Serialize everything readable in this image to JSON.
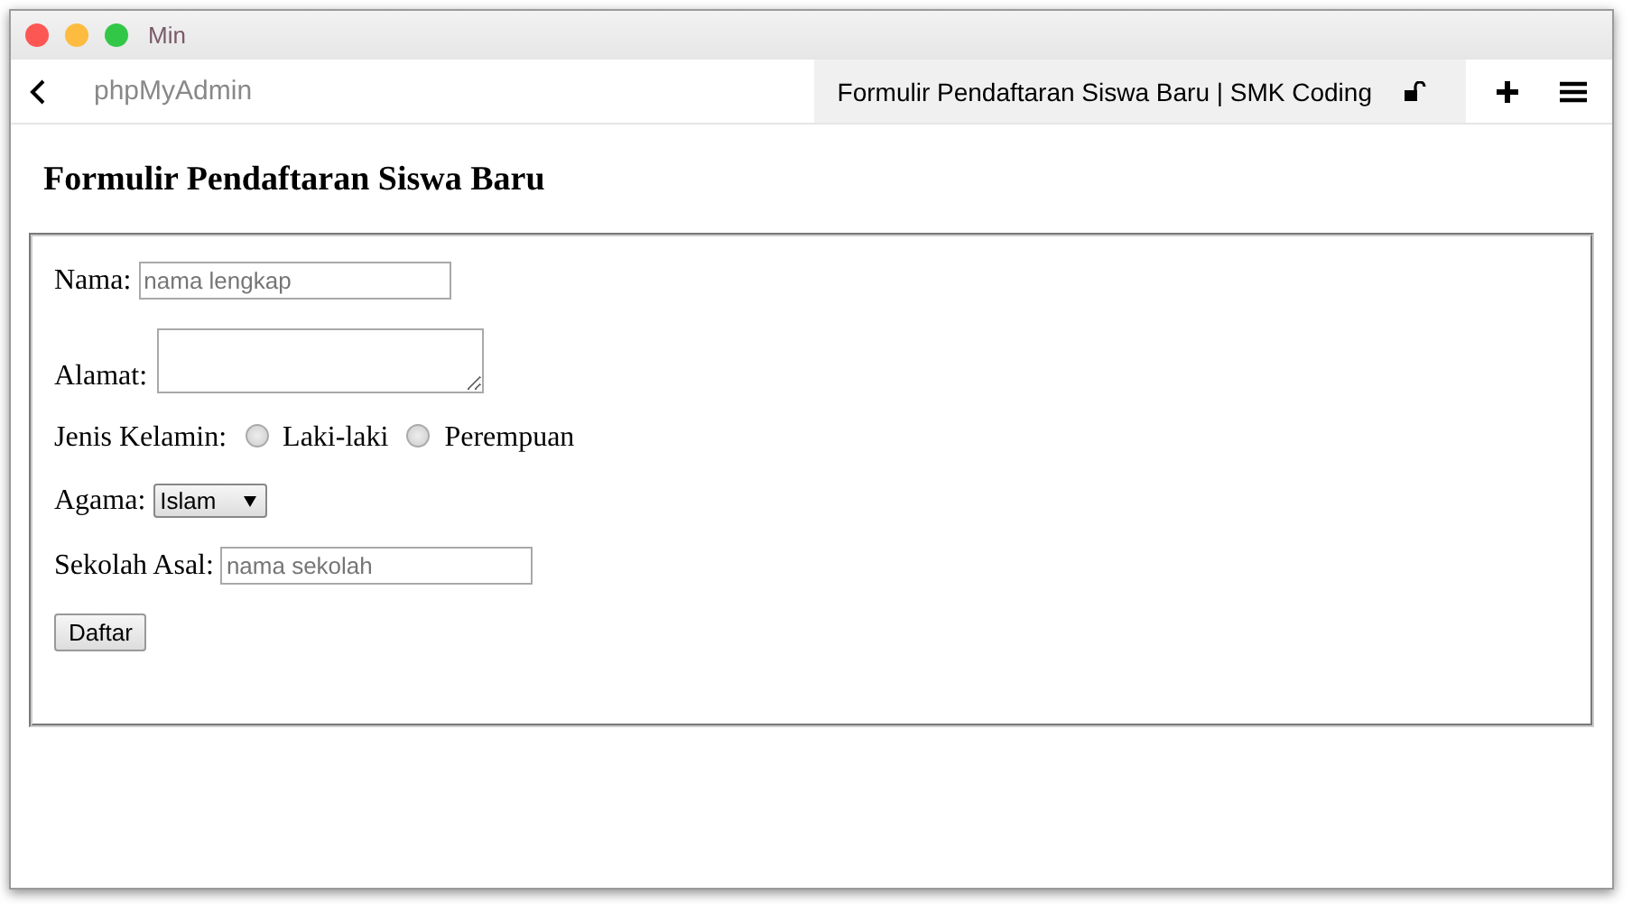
{
  "window": {
    "title": "Min"
  },
  "nav": {
    "back_label": "phpMyAdmin",
    "tab_title": "Formulir Pendaftaran Siswa Baru | SMK Coding"
  },
  "page": {
    "heading": "Formulir Pendaftaran Siswa Baru",
    "name_field": {
      "label": "Nama:",
      "placeholder": "nama lengkap"
    },
    "address_field": {
      "label": "Alamat:"
    },
    "gender": {
      "label": "Jenis Kelamin:",
      "options": [
        {
          "label": "Laki-laki",
          "selected": false
        },
        {
          "label": "Perempuan",
          "selected": false
        }
      ]
    },
    "religion": {
      "label": "Agama:",
      "value": "Islam"
    },
    "school_field": {
      "label": "Sekolah Asal:",
      "placeholder": "nama sekolah"
    },
    "submit": "Daftar"
  }
}
